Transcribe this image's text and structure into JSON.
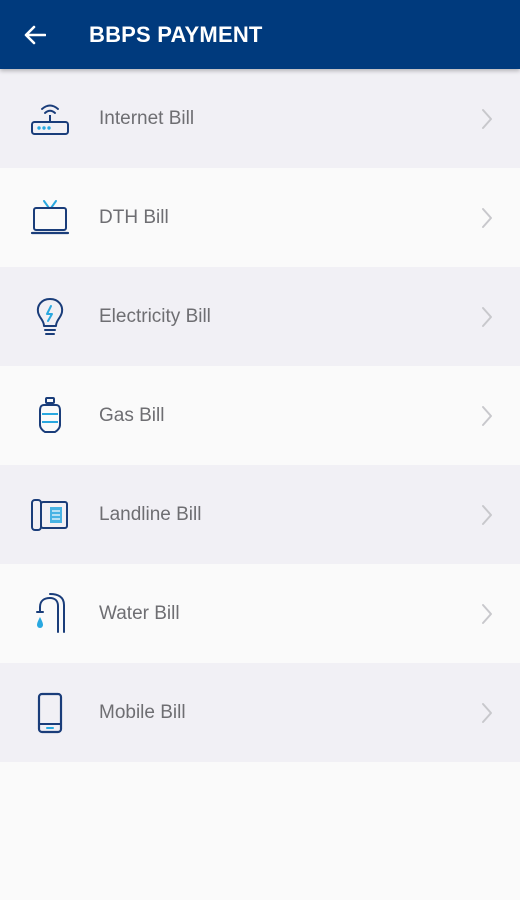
{
  "header": {
    "title": "BBPS PAYMENT",
    "back_icon": "arrow-left-icon",
    "background": "#003a7d",
    "text_color": "#ffffff"
  },
  "colors": {
    "icon_primary": "#1a3d7a",
    "icon_accent": "#29a8e0",
    "label": "#6e6e72",
    "row_alt": "#f1f0f5",
    "row_plain": "#fafafa",
    "chevron": "#c8c8cc"
  },
  "bills": [
    {
      "label": "Internet Bill",
      "icon": "router-icon"
    },
    {
      "label": "DTH Bill",
      "icon": "tv-icon"
    },
    {
      "label": "Electricity Bill",
      "icon": "bulb-icon"
    },
    {
      "label": "Gas Bill",
      "icon": "gas-cylinder-icon"
    },
    {
      "label": "Landline Bill",
      "icon": "landline-phone-icon"
    },
    {
      "label": "Water Bill",
      "icon": "water-tap-icon"
    },
    {
      "label": "Mobile Bill",
      "icon": "mobile-phone-icon"
    }
  ]
}
